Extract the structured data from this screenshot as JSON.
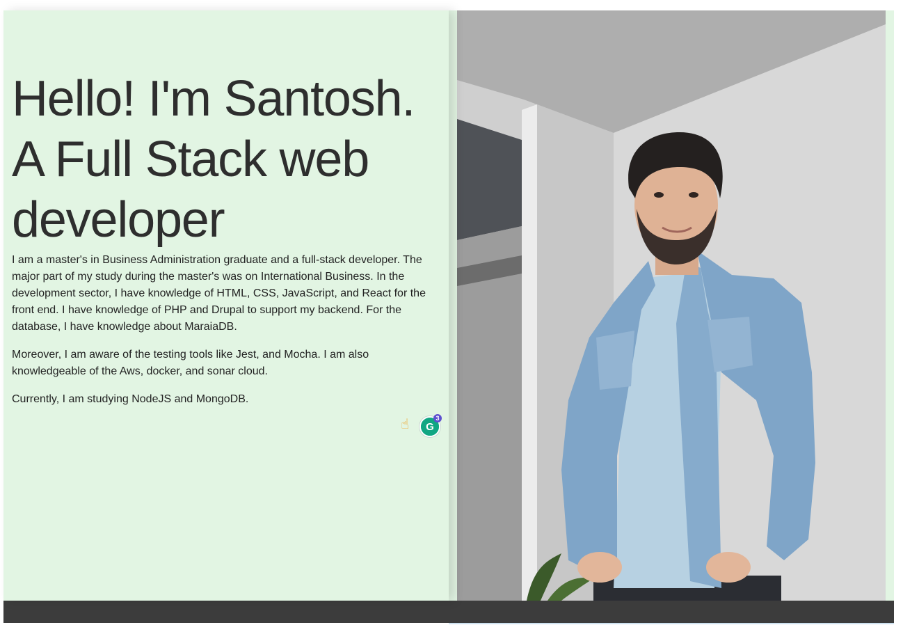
{
  "hero": {
    "heading_lines": [
      "Hello! I'm Santosh.",
      "A Full Stack web",
      "developer"
    ]
  },
  "bio": {
    "paragraphs": [
      "I am a master's in Business Administration graduate and a full-stack developer. The major part of my study during the master's was on International Business. In the development sector, I have knowledge of HTML, CSS, JavaScript, and React for the front end. I have knowledge of PHP and Drupal to support my backend. For the database, I have knowledge about MaraiaDB.",
      "Moreover, I am aware of the testing tools like Jest, and Mocha. I am also knowledgeable of the Aws, docker, and sonar cloud.",
      "Currently, I am studying NodeJS and MongoDB."
    ]
  },
  "extension": {
    "pointer_emoji": "☝",
    "grammarly_letter": "G",
    "grammarly_badge_count": "3"
  },
  "photo": {
    "subject": "portrait-photo",
    "jacket_color": "#7fa5c8",
    "shirt_color": "#b7d1e2"
  },
  "colors": {
    "page_background": "#e2f5e3",
    "footer": "#3c3c3c",
    "heading_text": "#2e2e2e"
  }
}
